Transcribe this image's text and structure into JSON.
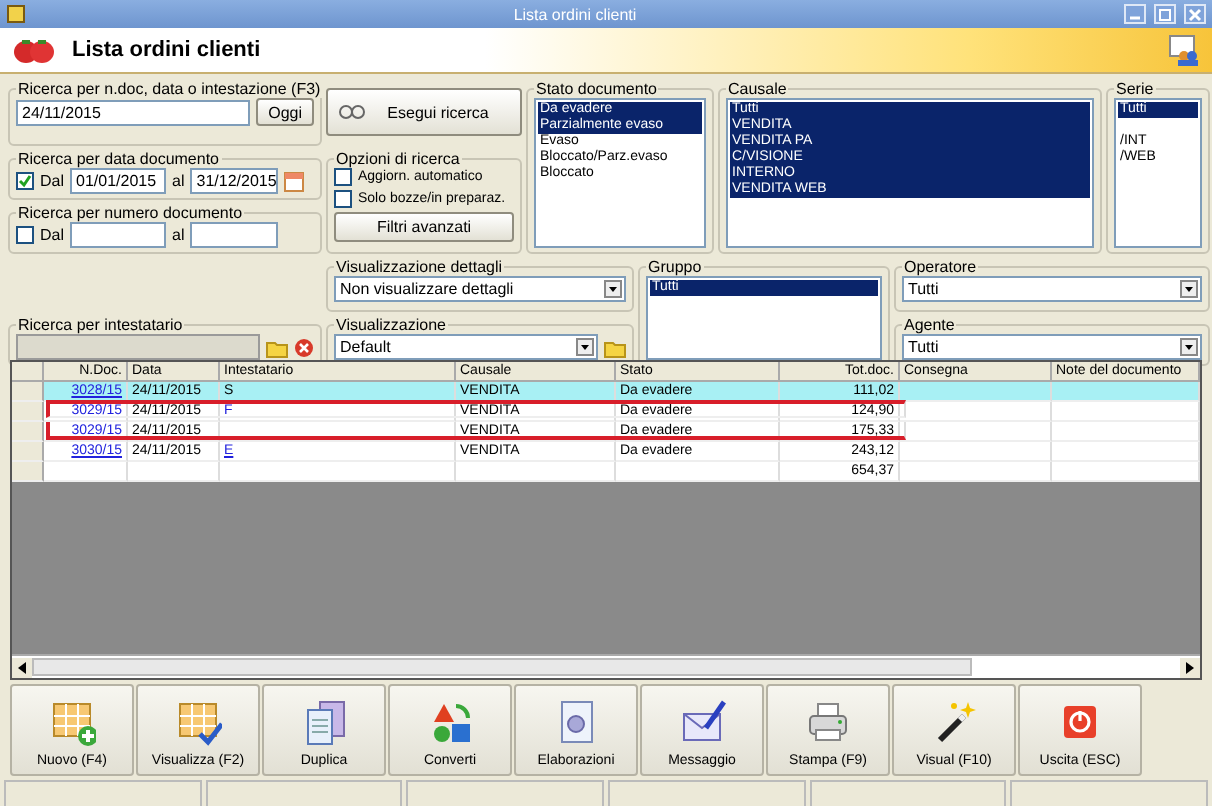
{
  "window": {
    "title": "Lista ordini clienti"
  },
  "header": {
    "title": "Lista ordini clienti"
  },
  "search_doc": {
    "label": "Ricerca per n.doc, data o intestazione (F3)",
    "value": "24/11/2015",
    "button": "Oggi"
  },
  "date_search": {
    "label": "Ricerca per data documento",
    "checkbox": "Dal",
    "checked": true,
    "from": "01/01/2015",
    "to_label": "al",
    "to": "31/12/2015"
  },
  "number_search": {
    "label": "Ricerca per numero documento",
    "checkbox": "Dal",
    "checked": false,
    "to_label": "al"
  },
  "holder_search": {
    "label": "Ricerca per intestatario"
  },
  "search_button": "Esegui ricerca",
  "options": {
    "label": "Opzioni di ricerca",
    "items": [
      {
        "label": "Aggiorn. automatico",
        "checked": false
      },
      {
        "label": "Solo bozze/in preparaz.",
        "checked": false
      }
    ],
    "button": "Filtri avanzati"
  },
  "status_list": {
    "label": "Stato documento",
    "items": [
      {
        "label": "Da evadere",
        "selected": true
      },
      {
        "label": "Parzialmente evaso",
        "selected": true
      },
      {
        "label": "Evaso",
        "selected": false
      },
      {
        "label": "Bloccato/Parz.evaso",
        "selected": false
      },
      {
        "label": "Bloccato",
        "selected": false
      }
    ]
  },
  "causale_list": {
    "label": "Causale",
    "items": [
      {
        "label": "Tutti",
        "selected": true
      },
      {
        "label": "VENDITA",
        "selected": true
      },
      {
        "label": "VENDITA PA",
        "selected": true
      },
      {
        "label": "C/VISIONE",
        "selected": true
      },
      {
        "label": "INTERNO",
        "selected": true
      },
      {
        "label": "VENDITA WEB",
        "selected": true
      }
    ]
  },
  "serie_list": {
    "label": "Serie",
    "items": [
      {
        "label": "Tutti",
        "selected": true
      },
      {
        "label": "/INT",
        "selected": false
      },
      {
        "label": "/WEB",
        "selected": false
      }
    ]
  },
  "details_view": {
    "label": "Visualizzazione dettagli",
    "value": "Non visualizzare dettagli"
  },
  "view": {
    "label": "Visualizzazione",
    "value": "Default"
  },
  "group_list": {
    "label": "Gruppo",
    "items": [
      {
        "label": "Tutti",
        "selected": true
      }
    ]
  },
  "operator": {
    "label": "Operatore",
    "value": "Tutti"
  },
  "agent": {
    "label": "Agente",
    "value": "Tutti"
  },
  "table": {
    "columns": [
      "N.Doc.",
      "Data",
      "Intestatario",
      "Causale",
      "Stato",
      "Tot.doc.",
      "Consegna",
      "Note del documento"
    ],
    "rows": [
      {
        "n_doc": "3028/15",
        "data": "24/11/2015",
        "intestatario": "S",
        "causale": "VENDITA",
        "stato": "Da evadere",
        "tot": "111,02",
        "selected": true,
        "highlighted": false
      },
      {
        "n_doc": "3029/15",
        "data": "24/11/2015",
        "intestatario": "F",
        "causale": "VENDITA",
        "stato": "Da evadere",
        "tot": "124,90",
        "selected": false,
        "highlighted": true
      },
      {
        "n_doc": "3029/15",
        "data": "24/11/2015",
        "causale": "VENDITA",
        "stato": "Da evadere",
        "tot": "175,33",
        "selected": false,
        "highlighted": true
      },
      {
        "n_doc": "3030/15",
        "data": "24/11/2015",
        "intestatario": "E",
        "causale": "VENDITA",
        "stato": "Da evadere",
        "tot": "243,12",
        "selected": false,
        "highlighted": false
      }
    ],
    "total": "654,37"
  },
  "toolbar": [
    {
      "label": "Nuovo (F4)",
      "kind": "new"
    },
    {
      "label": "Visualizza (F2)",
      "kind": "view"
    },
    {
      "label": "Duplica",
      "kind": "duplicate"
    },
    {
      "label": "Converti",
      "kind": "convert"
    },
    {
      "label": "Elaborazioni",
      "kind": "process"
    },
    {
      "label": "Messaggio",
      "kind": "message"
    },
    {
      "label": "Stampa (F9)",
      "kind": "print"
    },
    {
      "label": "Visual (F10)",
      "kind": "wand"
    },
    {
      "label": "Uscita (ESC)",
      "kind": "exit"
    }
  ]
}
